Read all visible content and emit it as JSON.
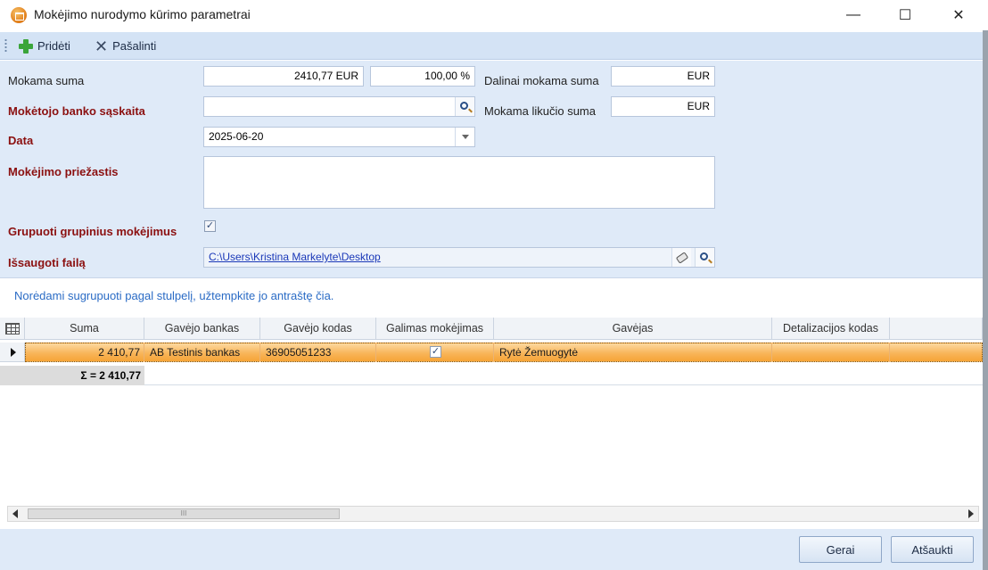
{
  "window": {
    "title": "Mokėjimo nurodymo kūrimo parametrai",
    "min_glyph": "—",
    "max_glyph": "☐",
    "close_glyph": "✕"
  },
  "toolbar": {
    "add_label": "Pridėti",
    "remove_label": "Pašalinti"
  },
  "form": {
    "mokama_suma_label": "Mokama suma",
    "mokama_suma_value": "2410,77 EUR",
    "percent_value": "100,00 %",
    "dalinai_label": "Dalinai mokama suma",
    "dalinai_value": "EUR",
    "saskaita_label": "Mokėtojo banko sąskaita",
    "saskaita_value": "",
    "likucio_label": "Mokama likučio suma",
    "likucio_value": "EUR",
    "data_label": "Data",
    "data_value": "2025-06-20",
    "priezastis_label": "Mokėjimo priežastis",
    "priezastis_value": "",
    "grupuoti_label": "Grupuoti grupinius mokėjimus",
    "grupuoti_checked": true,
    "issaugoti_label": "Išsaugoti failą",
    "issaugoti_value": "C:\\Users\\Kristina Markelyte\\Desktop"
  },
  "grid": {
    "group_hint": "Norėdami sugrupuoti pagal stulpelį, užtempkite jo antraštę čia.",
    "columns": [
      "Suma",
      "Gavėjo bankas",
      "Gavėjo kodas",
      "Galimas mokėjimas",
      "Gavėjas",
      "Detalizacijos kodas"
    ],
    "rows": [
      {
        "suma": "2 410,77",
        "bankas": "AB Testinis bankas",
        "kodas": "36905051233",
        "galimas": true,
        "gavejas": "Rytė Žemuogytė",
        "detalizacijos": ""
      }
    ],
    "summary": "Σ = 2 410,77",
    "scroll_grip": "III"
  },
  "buttons": {
    "ok_label": "Gerai",
    "cancel_label": "Atšaukti"
  }
}
